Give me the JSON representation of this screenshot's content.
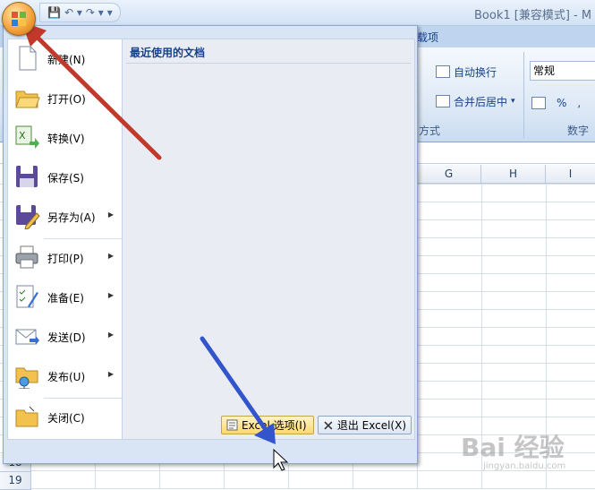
{
  "window": {
    "title": "Book1  [兼容模式] - M"
  },
  "qat": {
    "save": "💾",
    "undo": "↶ ▾",
    "redo": "↷ ▾",
    "more": "▾"
  },
  "ribbon": {
    "tab_addins": "载项",
    "wrap_text": "自动换行",
    "merge_center": "合并后居中",
    "merge_arrow": "▾",
    "number_format": "常规",
    "alignment_group": "方式",
    "number_group": "数字",
    "percent": "%",
    "comma": ","
  },
  "sheet": {
    "columns": [
      "G",
      "H",
      "I"
    ],
    "rows": [
      "18",
      "19"
    ]
  },
  "office_menu": {
    "recent_title": "最近使用的文档",
    "items": [
      {
        "label": "新建(N)",
        "icon": "new-document-icon",
        "submenu": false
      },
      {
        "label": "打开(O)",
        "icon": "open-folder-icon",
        "submenu": false
      },
      {
        "label": "转换(V)",
        "icon": "convert-icon",
        "submenu": false
      },
      {
        "label": "保存(S)",
        "icon": "save-floppy-icon",
        "submenu": false
      },
      {
        "label": "另存为(A)",
        "icon": "save-as-icon",
        "submenu": true
      },
      {
        "label": "打印(P)",
        "icon": "printer-icon",
        "submenu": true
      },
      {
        "label": "准备(E)",
        "icon": "prepare-icon",
        "submenu": true
      },
      {
        "label": "发送(D)",
        "icon": "send-icon",
        "submenu": true
      },
      {
        "label": "发布(U)",
        "icon": "publish-icon",
        "submenu": true
      },
      {
        "label": "关闭(C)",
        "icon": "close-folder-icon",
        "submenu": false
      }
    ],
    "excel_options": "Excel 选项(I)",
    "exit_excel": "退出 Excel(X)"
  },
  "watermark": {
    "text": "Bai 经验",
    "sub": "jingyan.baidu.com"
  },
  "colors": {
    "red_arrow": "#c0392b",
    "blue_arrow": "#3355cc"
  }
}
